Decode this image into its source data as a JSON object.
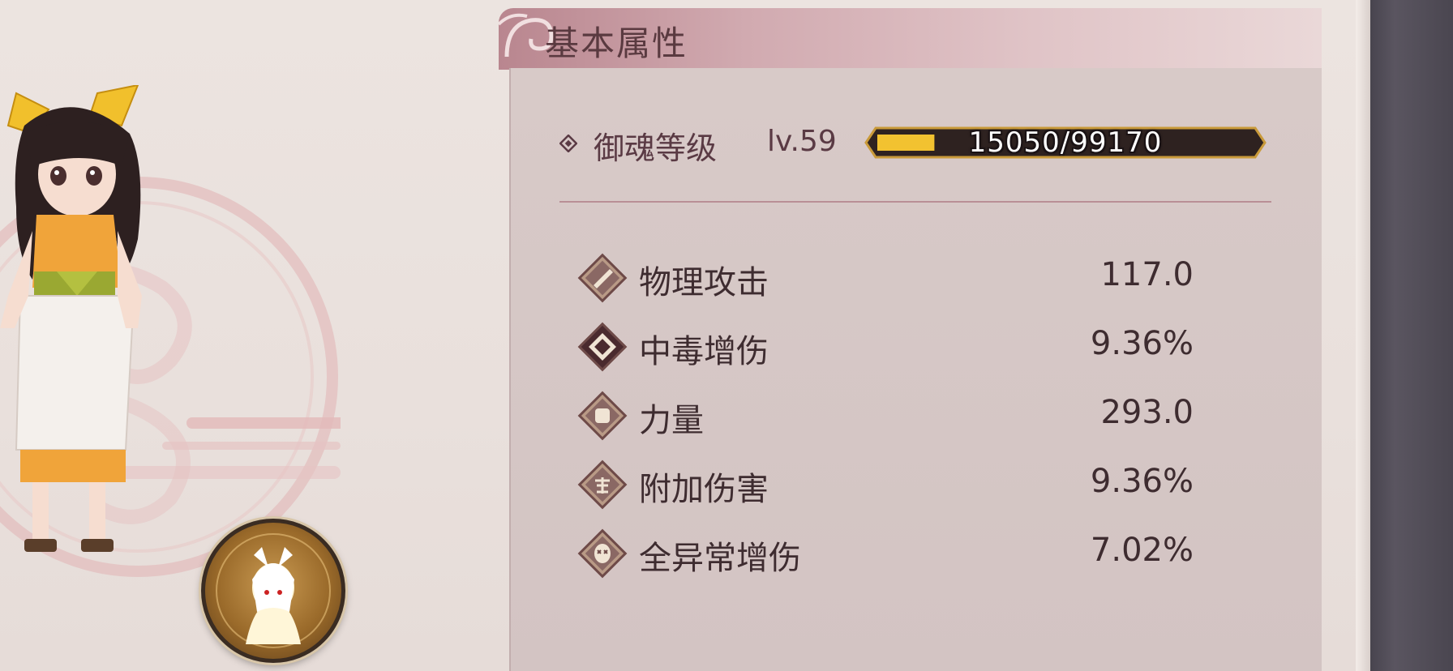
{
  "panel": {
    "title": "基本属性"
  },
  "level": {
    "label": "御魂等级",
    "value": "lv.59",
    "exp_text": "15050/99170",
    "exp_current": 15050,
    "exp_max": 99170
  },
  "stats": [
    {
      "name": "物理攻击",
      "value": "117.0",
      "icon": "sword-icon"
    },
    {
      "name": "中毒增伤",
      "value": "9.36%",
      "icon": "poison-icon"
    },
    {
      "name": "力量",
      "value": "293.0",
      "icon": "fist-icon"
    },
    {
      "name": "附加伤害",
      "value": "9.36%",
      "icon": "bonus-damage-icon"
    },
    {
      "name": "全异常增伤",
      "value": "7.02%",
      "icon": "mask-icon"
    }
  ],
  "colors": {
    "accent_gold": "#f2c230",
    "panel_bg": "#d6c7c6",
    "header_rose": "#c49aa2"
  }
}
